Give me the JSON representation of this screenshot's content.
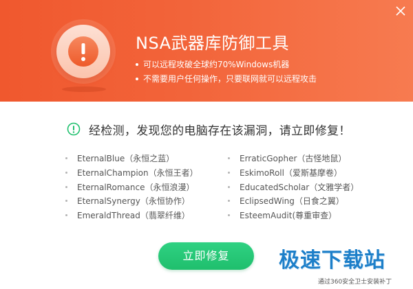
{
  "window": {
    "title": "NSA武器库防御工具",
    "bullets": [
      "可以远程攻破全球约70%Windows机器",
      "不需要用户任何操作，只要联网就可以远程攻击"
    ],
    "accent_color": "#f2643a"
  },
  "icons": {
    "close": "close-icon",
    "alert": "exclamation-icon",
    "check": "check-circle-icon"
  },
  "detection": {
    "message": "经检测，发现您的电脑存在该漏洞，请立即修复！",
    "color": "#20c06e"
  },
  "vulnerabilities": {
    "left": [
      "EternalBlue（永恒之蓝）",
      "EternalChampion（永恒王者）",
      "EternalRomance（永恒浪漫）",
      "EternalSynergy（永恒协作）",
      "EmeraldThread（翡翠纤维）"
    ],
    "right": [
      "ErraticGopher（古怪地鼠）",
      "EskimoRoll（爱斯基摩卷）",
      "EducatedScholar（文雅学者）",
      "EclipsedWing（日食之翼）",
      "EsteemAudit(尊重审查）"
    ]
  },
  "actions": {
    "repair_label": "立即修复",
    "button_color": "#22c472"
  },
  "watermark": {
    "logo": "极速下载站",
    "subtitle": "通过360安全卫士安装补丁"
  }
}
